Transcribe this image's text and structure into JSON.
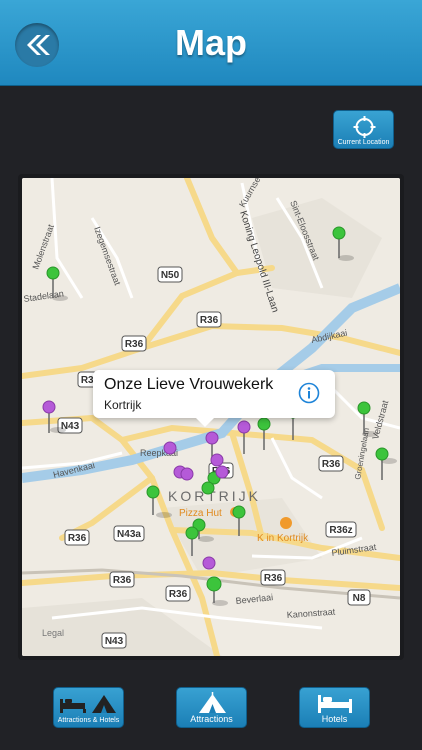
{
  "header": {
    "title": "Map"
  },
  "current_location": {
    "label": "Current Location"
  },
  "map": {
    "roads": [
      "N50",
      "R36",
      "R36",
      "R36",
      "N43",
      "R36",
      "R36",
      "N43a",
      "R36",
      "R36",
      "R36",
      "R36z",
      "N8",
      "N43",
      "R36"
    ],
    "street_names": [
      "Molenstraat",
      "Izegemsestraat",
      "Stadelaan",
      "Kuurnse",
      "Koning Leopold III-Laan",
      "Sint-Eloosstraat",
      "Abdijkaai",
      "Veldstraat",
      "Groeningelaan",
      "Havenkaai",
      "Reepkaai",
      "Pluimstraat",
      "Kanonstraat",
      "Beverlaai"
    ],
    "city_label": "KORTRIJK",
    "poi": [
      "Pizza Hut",
      "K in Kortrijk"
    ],
    "legal": "Legal"
  },
  "callout": {
    "title": "Onze Lieve Vrouwekerk",
    "subtitle": "Kortrijk"
  },
  "tabs": [
    {
      "label": "Attractions & Hotels"
    },
    {
      "label": "Attractions"
    },
    {
      "label": "Hotels"
    }
  ],
  "colors": {
    "pin_green": "#3cc43c",
    "pin_purple": "#b55ad8",
    "accent": "#2a93c9"
  }
}
